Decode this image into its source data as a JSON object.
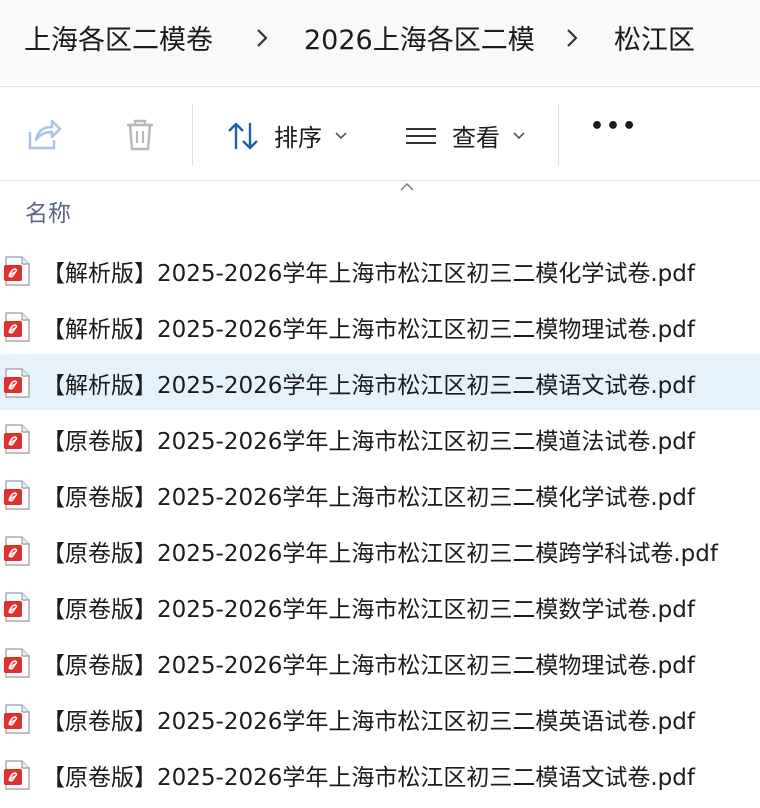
{
  "breadcrumb": {
    "items": [
      {
        "label": "上海各区二模卷"
      },
      {
        "label": "2026上海各区二模"
      },
      {
        "label": "松江区"
      }
    ]
  },
  "toolbar": {
    "share_icon": "share-icon",
    "delete_icon": "trash-icon",
    "sort_label": "排序",
    "view_label": "查看",
    "more_label": "•••"
  },
  "list_header": {
    "name_column": "名称"
  },
  "files": [
    {
      "name": "【解析版】2025-2026学年上海市松江区初三二模化学试卷.pdf",
      "icon": "pdf-icon",
      "selected": false
    },
    {
      "name": "【解析版】2025-2026学年上海市松江区初三二模物理试卷.pdf",
      "icon": "pdf-icon",
      "selected": false
    },
    {
      "name": "【解析版】2025-2026学年上海市松江区初三二模语文试卷.pdf",
      "icon": "pdf-icon",
      "selected": true
    },
    {
      "name": "【原卷版】2025-2026学年上海市松江区初三二模道法试卷.pdf",
      "icon": "pdf-icon",
      "selected": false
    },
    {
      "name": "【原卷版】2025-2026学年上海市松江区初三二模化学试卷.pdf",
      "icon": "pdf-icon",
      "selected": false
    },
    {
      "name": "【原卷版】2025-2026学年上海市松江区初三二模跨学科试卷.pdf",
      "icon": "pdf-icon",
      "selected": false
    },
    {
      "name": "【原卷版】2025-2026学年上海市松江区初三二模数学试卷.pdf",
      "icon": "pdf-icon",
      "selected": false
    },
    {
      "name": "【原卷版】2025-2026学年上海市松江区初三二模物理试卷.pdf",
      "icon": "pdf-icon",
      "selected": false
    },
    {
      "name": "【原卷版】2025-2026学年上海市松江区初三二模英语试卷.pdf",
      "icon": "pdf-icon",
      "selected": false
    },
    {
      "name": "【原卷版】2025-2026学年上海市松江区初三二模语文试卷.pdf",
      "icon": "pdf-icon",
      "selected": false
    }
  ],
  "colors": {
    "selected_row": "#e5f1fb",
    "pdf_red": "#e0302d",
    "accent_blue": "#1f5fa8"
  }
}
